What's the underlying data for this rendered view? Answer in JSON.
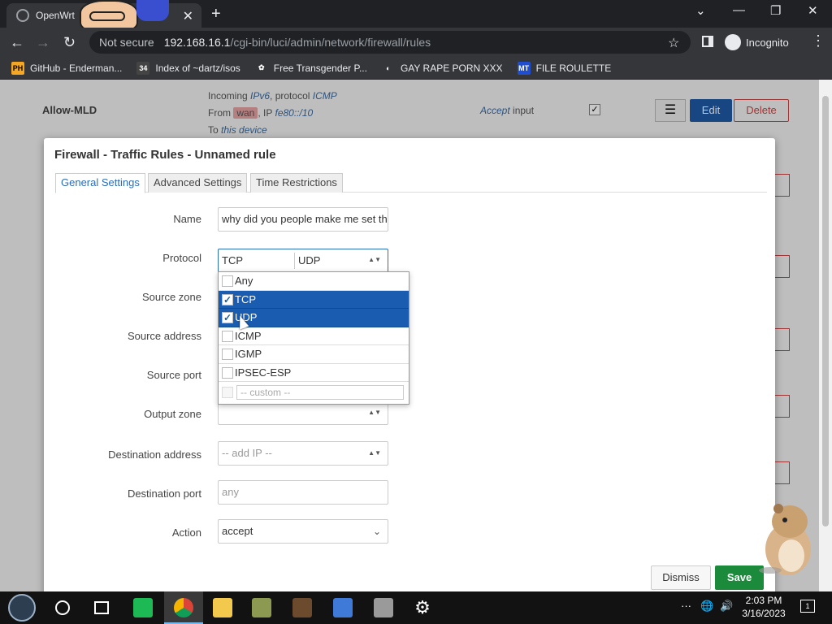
{
  "browser": {
    "tab_title": "OpenWrt",
    "tab_close": "✕",
    "new_tab": "+",
    "win_min": "—",
    "win_restore": "❐",
    "win_close": "✕",
    "not_secure": "Not secure",
    "url_host": "192.168.16.1",
    "url_path": "/cgi-bin/luci/admin/network/firewall/rules",
    "incognito": "Incognito",
    "bookmarks": [
      {
        "label": "GitHub - Enderman...",
        "icon": "PH",
        "color": "#f5a623",
        "fg": "#000"
      },
      {
        "label": "Index of ~dartz/isos",
        "icon": "34",
        "color": "#444",
        "fg": "#fff"
      },
      {
        "label": "Free Transgender P...",
        "icon": "✿",
        "color": "#35363a",
        "fg": "#fff"
      },
      {
        "label": "GAY RAPE PORN XXX",
        "icon": "◐",
        "color": "#35363a",
        "fg": "#fff"
      },
      {
        "label": "FILE ROULETTE",
        "icon": "MT",
        "color": "#1f4fd0",
        "fg": "#fff"
      }
    ]
  },
  "background_rule": {
    "name": "Allow-MLD",
    "line1_prefix": "Incoming ",
    "line1_ipv": "IPv6",
    "line1_mid": ", protocol ",
    "line1_proto": "ICMP",
    "line2_from": "From ",
    "line2_wan": "wan",
    "line2_ip": ", IP ",
    "line2_ipval": "fe80::/10",
    "line3_to": "To ",
    "line3_dev": "this device",
    "action_word": "Accept",
    "action_rest": " input",
    "menu_glyph": "☰",
    "edit": "Edit",
    "delete": "Delete"
  },
  "modal": {
    "title": "Firewall - Traffic Rules - Unnamed rule",
    "tabs": [
      "General Settings",
      "Advanced Settings",
      "Time Restrictions"
    ],
    "fields": {
      "name_label": "Name",
      "name_value": "why did you people make me set th",
      "protocol_label": "Protocol",
      "protocol_selected": [
        "TCP",
        "UDP"
      ],
      "source_zone_label": "Source zone",
      "source_address_label": "Source address",
      "source_port_label": "Source port",
      "output_zone_label": "Output zone",
      "dest_address_label": "Destination address",
      "dest_address_placeholder": "-- add IP --",
      "dest_port_label": "Destination port",
      "dest_port_placeholder": "any",
      "action_label": "Action",
      "action_value": "accept"
    },
    "protocol_options": [
      {
        "label": "Any",
        "checked": false
      },
      {
        "label": "TCP",
        "checked": true
      },
      {
        "label": "UDP",
        "checked": true
      },
      {
        "label": "ICMP",
        "checked": false
      },
      {
        "label": "IGMP",
        "checked": false
      },
      {
        "label": "IPSEC-ESP",
        "checked": false
      }
    ],
    "custom_placeholder": "-- custom --",
    "dismiss": "Dismiss",
    "save": "Save"
  },
  "taskbar": {
    "time": "2:03 PM",
    "date": "3/16/2023",
    "notif_count": "1"
  }
}
